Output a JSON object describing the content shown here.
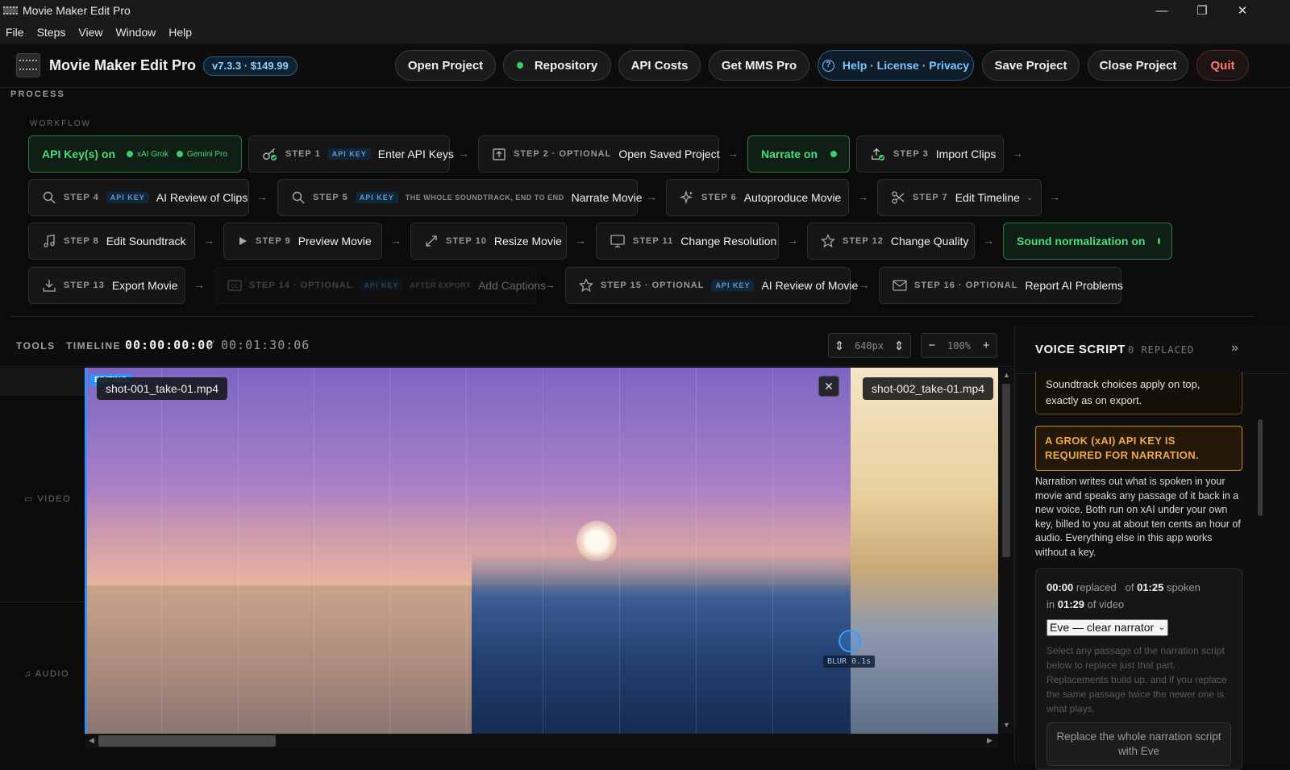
{
  "window": {
    "title": "Movie Maker Edit Pro",
    "controls": [
      "—",
      "❐",
      "✕"
    ]
  },
  "menu": [
    "File",
    "Steps",
    "View",
    "Window",
    "Help"
  ],
  "header": {
    "app_name": "Movie Maker Edit Pro",
    "version": "v7.3.3 · $149.99",
    "buttons": {
      "open_project": "Open Project",
      "repository": "Repository",
      "api_costs": "API Costs",
      "get_pro": "Get MMS Pro",
      "help": "Help · License · Privacy",
      "save_project": "Save Project",
      "close_project": "Close Project",
      "quit": "Quit"
    }
  },
  "process": {
    "label": "PROCESS",
    "workflow_label": "WORKFLOW",
    "api_status": {
      "label": "API Key(s) on",
      "xai": "xAI Grok",
      "gemini": "Gemini Pro"
    },
    "narrate_status": "Narrate on",
    "sound_norm_status": "Sound normalization on",
    "api_key_tag": "API KEY",
    "steps": {
      "s1": {
        "num": "STEP 1",
        "label": "Enter API Keys"
      },
      "s2": {
        "num": "STEP 2 · OPTIONAL",
        "label": "Open Saved Project"
      },
      "s3": {
        "num": "STEP 3",
        "label": "Import Clips"
      },
      "s4": {
        "num": "STEP 4",
        "label": "AI Review of Clips"
      },
      "s5": {
        "num": "STEP 5",
        "sub": "THE WHOLE SOUNDTRACK, END TO END",
        "label": "Narrate Movie"
      },
      "s6": {
        "num": "STEP 6",
        "label": "Autoproduce Movie"
      },
      "s7": {
        "num": "STEP 7",
        "label": "Edit Timeline"
      },
      "s8": {
        "num": "STEP 8",
        "label": "Edit Soundtrack"
      },
      "s9": {
        "num": "STEP 9",
        "label": "Preview Movie"
      },
      "s10": {
        "num": "STEP 10",
        "label": "Resize Movie"
      },
      "s11": {
        "num": "STEP 11",
        "label": "Change Resolution"
      },
      "s12": {
        "num": "STEP 12",
        "label": "Change Quality"
      },
      "s13": {
        "num": "STEP 13",
        "label": "Export Movie"
      },
      "s14": {
        "num": "STEP 14 · OPTIONAL",
        "sub": "AFTER EXPORT",
        "label": "Add Captions"
      },
      "s15": {
        "num": "STEP 15 · OPTIONAL",
        "label": "AI Review of Movie"
      },
      "s16": {
        "num": "STEP 16 · OPTIONAL",
        "label": "Report AI Problems"
      }
    }
  },
  "timeline": {
    "tools_label": "TOOLS",
    "timeline_label": "TIMELINE",
    "current": "00:00:00:00",
    "separator": "/",
    "total": "00:01:30:06",
    "height_value": "640px",
    "zoom_value": "100%",
    "zoom_out": "−",
    "zoom_in": "+",
    "tracks": {
      "video": "VIDEO",
      "audio": "AUDIO"
    },
    "editing_badge": "EDITING",
    "clip1": "shot-001_take-01.mp4",
    "clip2": "shot-002_take-01.mp4",
    "close": "✕",
    "blur_label": "BLUR 0.1s"
  },
  "voice_script": {
    "title": "VOICE SCRIPT",
    "replaced_count": "0 REPLACED",
    "collapse": "»",
    "note": "Soundtrack choices apply on top, exactly as on export.",
    "warning": "A GROK (xAI) API KEY IS REQUIRED FOR NARRATION.",
    "description": "Narration writes out what is spoken in your movie and speaks any passage of it back in a new voice. Both run on xAI under your own key, billed to you at about ten cents an hour of audio. Everything else in this app works without a key.",
    "stats": {
      "replaced_time": "00:00",
      "replaced_word": "replaced",
      "of_word": "of",
      "spoken_time": "01:25",
      "spoken_word": "spoken",
      "in_word": "in",
      "video_time": "01:29",
      "video_word": "of video"
    },
    "voice_selected": "Eve — clear narrator",
    "hint": "Select any passage of the narration script below to replace just that part. Replacements build up, and if you replace the same passage twice the newer one is what plays.",
    "replace_button": "Replace the whole narration script with Eve"
  },
  "colors": {
    "accent": "#2a93ff",
    "green": "#3ccf6a",
    "warning": "#f0a84a",
    "quit": "#ff7a6a"
  }
}
